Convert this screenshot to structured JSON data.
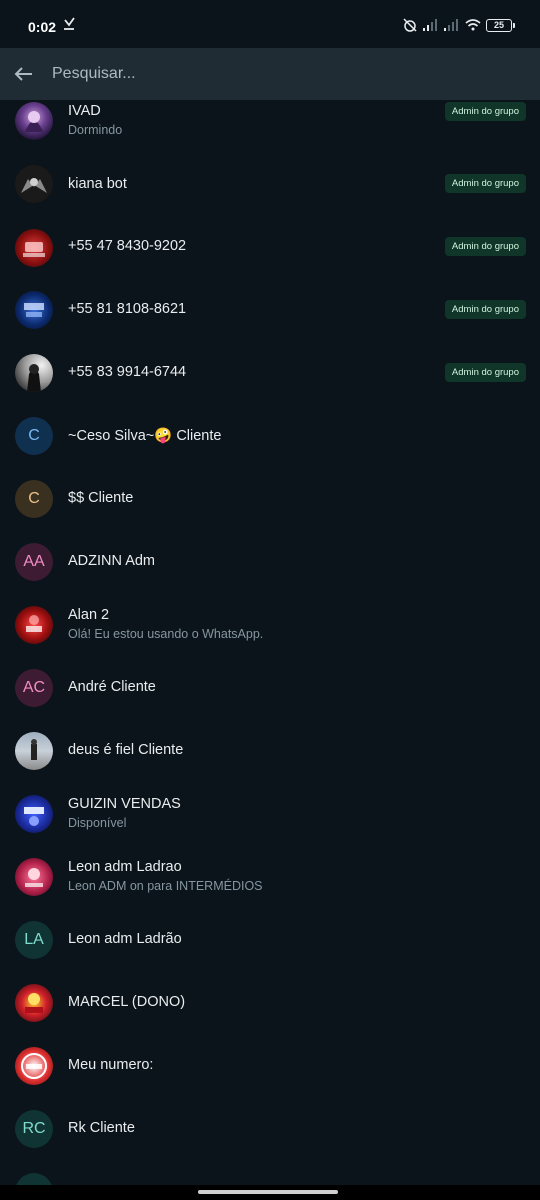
{
  "status_bar": {
    "time": "0:02",
    "battery": "25",
    "icons": [
      "download-icon",
      "alarm-off-icon",
      "signal-icon",
      "signal-icon",
      "wifi-icon",
      "battery-icon"
    ]
  },
  "search": {
    "placeholder": "Pesquisar..."
  },
  "colors": {
    "background": "#0b141a",
    "header": "#1f2c34",
    "badge_bg": "#103529",
    "badge_text": "#d1f4e0",
    "secondary_text": "#8696a0"
  },
  "participants": [
    {
      "name": "IVAD",
      "status": "Dormindo",
      "badge": "Admin do grupo",
      "avatar_initials": ""
    },
    {
      "name": "kiana bot",
      "status": "",
      "badge": "Admin do grupo",
      "avatar_initials": ""
    },
    {
      "name": "+55 47 8430-9202",
      "status": "",
      "badge": "Admin do grupo",
      "avatar_initials": ""
    },
    {
      "name": "+55 81 8108-8621",
      "status": "",
      "badge": "Admin do grupo",
      "avatar_initials": ""
    },
    {
      "name": "+55 83 9914-6744",
      "status": "",
      "badge": "Admin do grupo",
      "avatar_initials": ""
    },
    {
      "name": "~Ceso Silva~🤪 Cliente",
      "status": "",
      "badge": "",
      "avatar_initials": "C"
    },
    {
      "name": "$$ Cliente",
      "status": "",
      "badge": "",
      "avatar_initials": "C"
    },
    {
      "name": "ADZINN Adm",
      "status": "",
      "badge": "",
      "avatar_initials": "AA"
    },
    {
      "name": "Alan 2",
      "status": "Olá! Eu estou usando o WhatsApp.",
      "badge": "",
      "avatar_initials": ""
    },
    {
      "name": "André Cliente",
      "status": "",
      "badge": "",
      "avatar_initials": "AC"
    },
    {
      "name": "deus é fiel Cliente",
      "status": "",
      "badge": "",
      "avatar_initials": ""
    },
    {
      "name": "GUIZIN VENDAS",
      "status": "Disponível",
      "badge": "",
      "avatar_initials": ""
    },
    {
      "name": "Leon adm Ladrao",
      "status": "Leon ADM on para INTERMÉDIOS",
      "badge": "",
      "avatar_initials": ""
    },
    {
      "name": "Leon adm Ladrão",
      "status": "",
      "badge": "",
      "avatar_initials": "LA"
    },
    {
      "name": "MARCEL (DONO)",
      "status": "",
      "badge": "",
      "avatar_initials": ""
    },
    {
      "name": "Meu numero:",
      "status": "",
      "badge": "",
      "avatar_initials": ""
    },
    {
      "name": "Rk Cliente",
      "status": "",
      "badge": "",
      "avatar_initials": "RC"
    }
  ]
}
